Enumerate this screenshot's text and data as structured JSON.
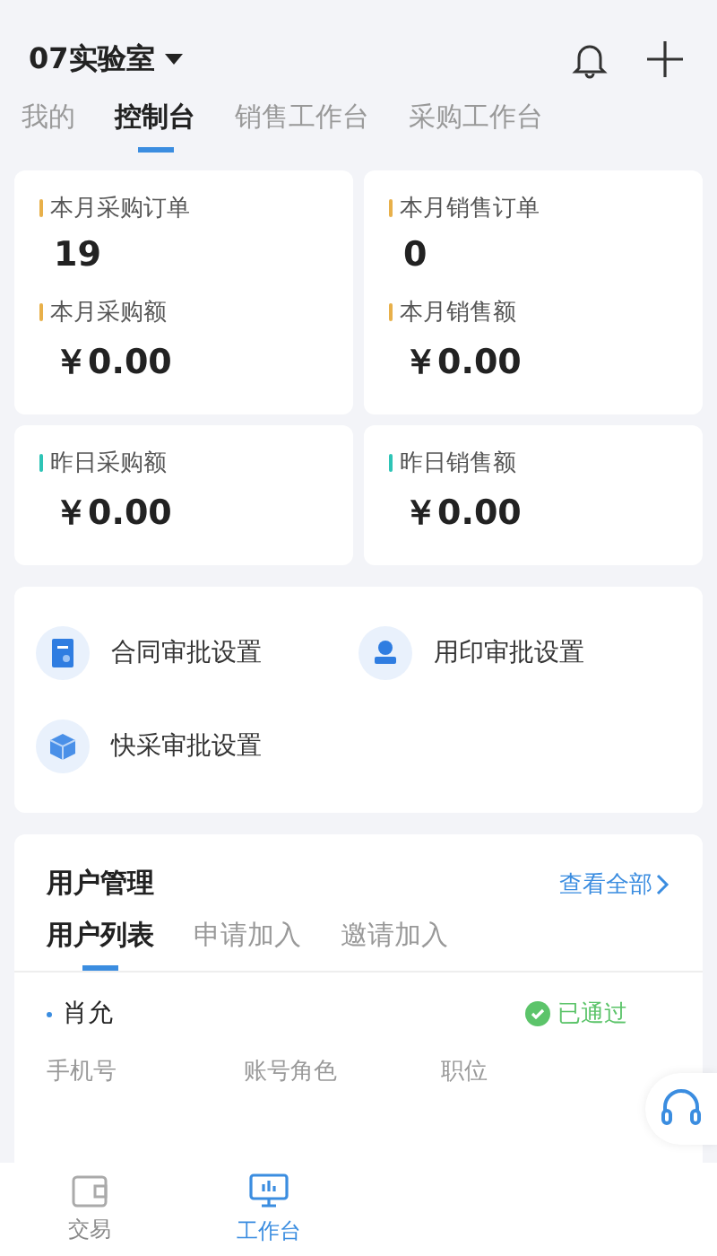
{
  "header": {
    "org": "07实验室"
  },
  "tabs": [
    {
      "label": "我的",
      "selected": false
    },
    {
      "label": "控制台",
      "selected": true
    },
    {
      "label": "销售工作台",
      "selected": false
    },
    {
      "label": "采购工作台",
      "selected": false
    }
  ],
  "stat_cards": [
    {
      "items": [
        {
          "label": "本月采购订单",
          "value": "19",
          "color": "#e8b04a"
        },
        {
          "label": "本月采购额",
          "value": "￥0.00",
          "color": "#e8b04a"
        }
      ]
    },
    {
      "items": [
        {
          "label": "本月销售订单",
          "value": "0",
          "color": "#e8b04a"
        },
        {
          "label": "本月销售额",
          "value": "￥0.00",
          "color": "#e8b04a"
        }
      ]
    },
    {
      "items": [
        {
          "label": "昨日采购额",
          "value": "￥0.00",
          "color": "#2ec4b6"
        }
      ]
    },
    {
      "items": [
        {
          "label": "昨日销售额",
          "value": "￥0.00",
          "color": "#2ec4b6"
        }
      ]
    }
  ],
  "approvals": [
    {
      "kind": "contract",
      "label": "合同审批设置"
    },
    {
      "kind": "seal",
      "label": "用印审批设置"
    },
    {
      "kind": "box",
      "label": "快采审批设置"
    }
  ],
  "user_management": {
    "title": "用户管理",
    "view_all": "查看全部",
    "tabs": [
      {
        "label": "用户列表",
        "selected": true
      },
      {
        "label": "申请加入",
        "selected": false
      },
      {
        "label": "邀请加入",
        "selected": false
      }
    ],
    "users": [
      {
        "name": "肖允",
        "status": "已通过",
        "approved": true,
        "fields": [
          "手机号",
          "账号角色",
          "职位"
        ]
      }
    ]
  },
  "bottom_nav": [
    {
      "kind": "wallet",
      "label": "交易",
      "selected": false
    },
    {
      "kind": "monitor",
      "label": "工作台",
      "selected": true
    }
  ]
}
